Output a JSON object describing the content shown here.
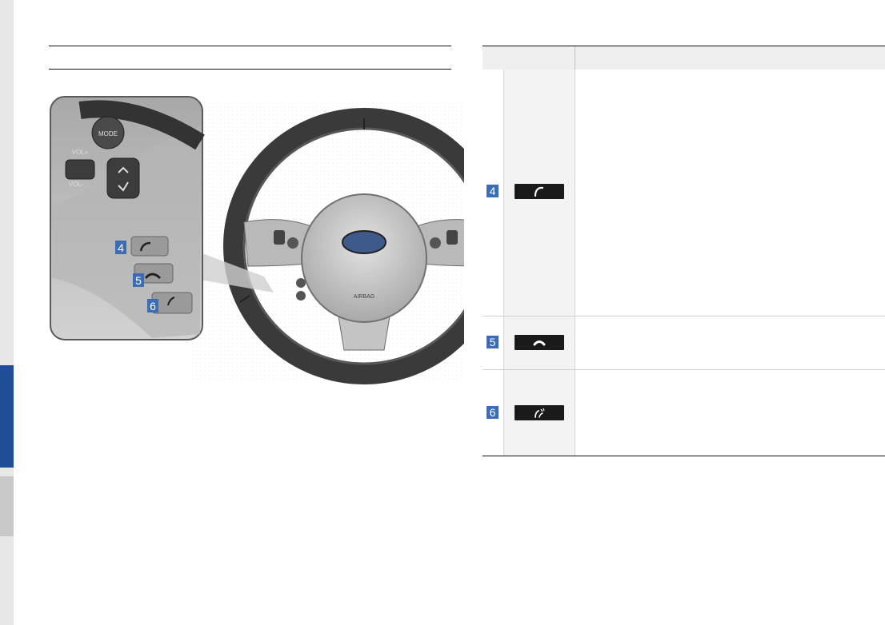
{
  "colors": {
    "accent": "#1f4e96",
    "badge": "#3c6cb4",
    "table_header_bg": "#efefef"
  },
  "left_column": {
    "heading": ""
  },
  "figure": {
    "wheel_logo_text": "AIRBAG",
    "callouts": [
      "4",
      "5",
      "6"
    ],
    "buttons": [
      "MODE",
      "VOL+",
      "VOL-"
    ]
  },
  "table": {
    "header": {
      "col1": "",
      "col2": ""
    },
    "rows": [
      {
        "num": "4",
        "icon": "call-icon",
        "description": ""
      },
      {
        "num": "5",
        "icon": "end-call-icon",
        "description": ""
      },
      {
        "num": "6",
        "icon": "voice-recognition-icon",
        "description": ""
      }
    ]
  }
}
